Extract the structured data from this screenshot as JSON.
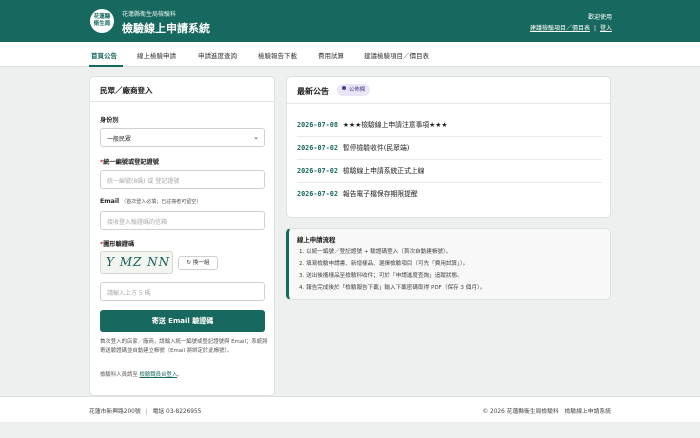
{
  "header": {
    "logo_line1": "花蓮縣",
    "logo_line2": "衛生局",
    "subtitle": "花蓮縣衛生局檢驗科",
    "title": "檢驗線上申請系統",
    "welcome": "歡迎使用",
    "links": [
      "建議檢驗項目／價目表",
      "登入"
    ],
    "link_separator": "|"
  },
  "nav": {
    "items": [
      "首頁公告",
      "線上檢驗申請",
      "申請進度查詢",
      "檢驗報告下載",
      "費用試算",
      "建議檢驗項目／價目表"
    ],
    "active": "首頁公告"
  },
  "login": {
    "title": "民眾／廠商登入",
    "identity_label": "身份別",
    "identity_value": "一般民眾",
    "id_label_required": "*",
    "id_label": "統一編號或登記證號",
    "id_placeholder": "統一編號(8碼) 或 登記證號",
    "email_label": "Email",
    "email_hint": "（首次登入必填；已註冊者可留空）",
    "email_placeholder": "接收登入驗證碼的信箱",
    "captcha_label_required": "*",
    "captcha_label": "圖形驗證碼",
    "captcha_text": "Y MZ NN",
    "refresh_label": "↻ 換一組",
    "captcha_placeholder": "請輸入上方 5 碼",
    "send_button": "寄送 Email 驗證碼",
    "note1": "首次登入的店家／廠商，請輸入統一編號或登記證號與 Email；系統將寄送驗證碼並自動建立帳號（Email 將綁定於此帳號）。",
    "note2_prefix": "檢驗科人員請至",
    "note2_link": "檢驗職員台登入",
    "note2_suffix": "。"
  },
  "news": {
    "title": "最新公告",
    "badge": "公佈欄",
    "items": [
      {
        "date": "2026-07-08",
        "text": "★★★檢驗線上申請注意事項★★★"
      },
      {
        "date": "2026-07-02",
        "text": "暫停檢驗收件(民眾端)"
      },
      {
        "date": "2026-07-02",
        "text": "檢驗線上申請系統正式上線"
      },
      {
        "date": "2026-07-02",
        "text": "報告電子檔保存期限提醒"
      }
    ]
  },
  "process": {
    "title": "線上申請流程",
    "steps": [
      "1. 以統一編號／登記證號 + 驗證碼登入（首次自動建帳號）。",
      "2. 填寫檢驗申請書、新增樣品、選擇檢驗項目（可先「費用試算」）。",
      "3. 送出後攜樣品至檢驗科收件；可於「申請進度查詢」追蹤狀態。",
      "4. 報告完成後於「檢驗報告下載」輸入下載密碼取得 PDF（保存 3 個月）。"
    ]
  },
  "footer": {
    "address": "花蓮市新興路200號",
    "phone": "電話 03-8226955",
    "copyright": "© 2026 花蓮縣衛生局檢驗科　檢驗線上申請系統"
  },
  "colors": {
    "primary": "#17695f",
    "badge_bg": "#ebe6f7",
    "badge_text": "#4d3b8f",
    "required": "#c0392b"
  }
}
